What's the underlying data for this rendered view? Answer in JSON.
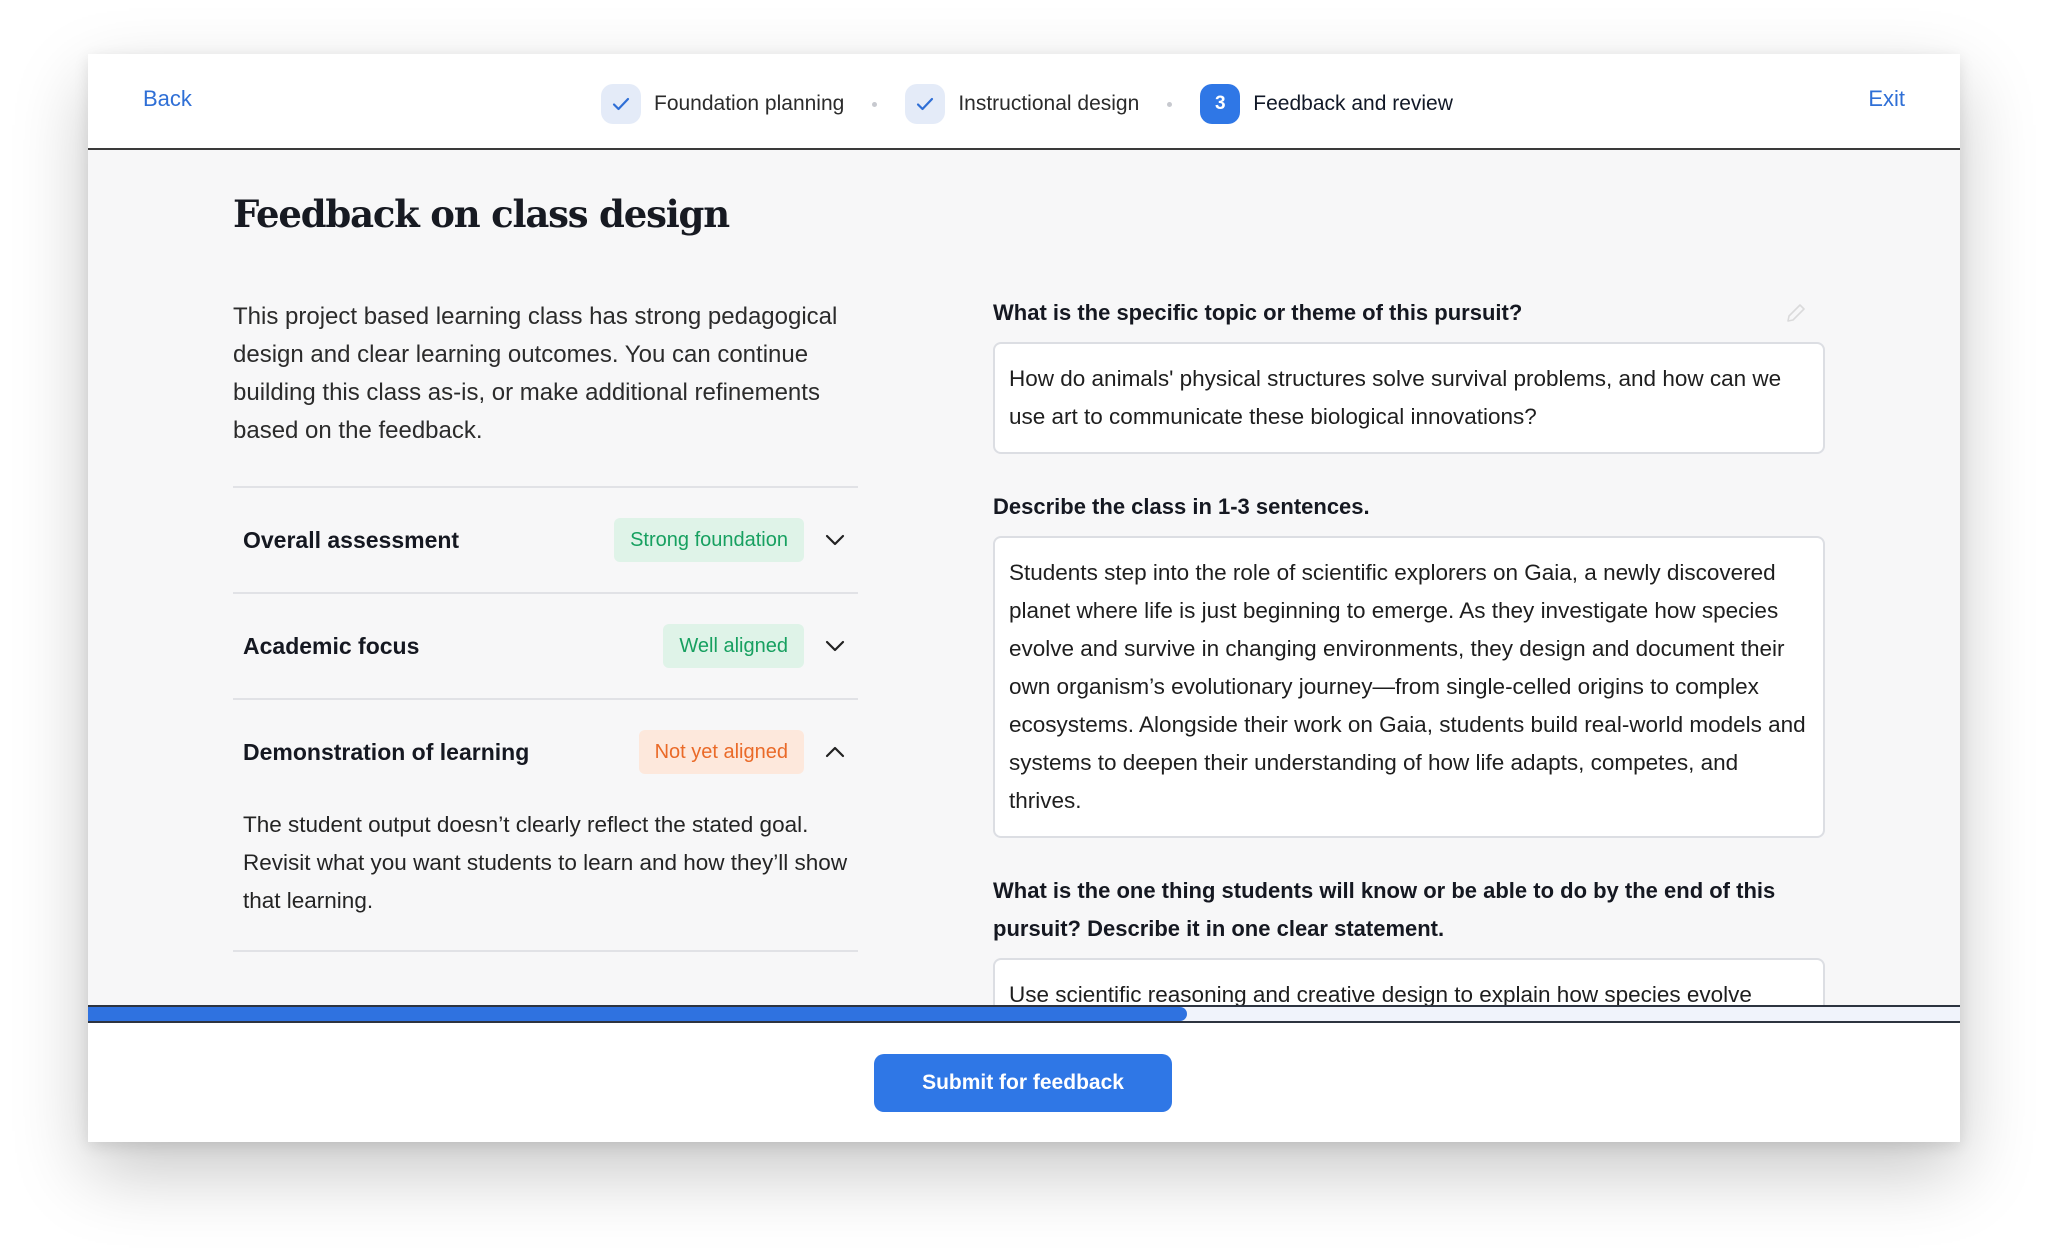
{
  "header": {
    "back_label": "Back",
    "exit_label": "Exit",
    "steps": [
      {
        "label": "Foundation planning",
        "state": "complete"
      },
      {
        "label": "Instructional design",
        "state": "complete"
      },
      {
        "label": "Feedback and review",
        "number": "3",
        "state": "active"
      }
    ]
  },
  "main": {
    "title": "Feedback on class design",
    "intro": "This project based learning class has strong pedagogical design and clear learning outcomes. You can continue building this class as-is, or make additional refinements based on the feedback.",
    "feedback": [
      {
        "title": "Overall assessment",
        "badge": "Strong foundation",
        "status": "green",
        "expanded": false
      },
      {
        "title": "Academic focus",
        "badge": "Well aligned",
        "status": "green",
        "expanded": false
      },
      {
        "title": "Demonstration of learning",
        "badge": "Not yet aligned",
        "status": "orange",
        "expanded": true,
        "body": "The student output doesn’t clearly reflect the stated goal. Revisit what you want students to learn and how they’ll show that learning."
      }
    ],
    "questions": [
      {
        "label": "What is the specific topic or theme of this pursuit?",
        "answer": "How do animals' physical structures solve survival problems, and how can we use art to communicate these biological innovations?"
      },
      {
        "label": "Describe the class in 1-3 sentences.",
        "answer": "Students step into the role of scientific explorers on Gaia, a newly discovered planet where life is just beginning to emerge. As they investigate how species evolve and survive in changing environments, they design and document their own organism’s evolutionary journey—from single-celled origins to complex ecosystems. Alongside their work on Gaia, students build real-world models and systems to deepen their understanding of how life adapts, competes, and thrives."
      },
      {
        "label": "What is the one thing students will know or be able to do by the end of this pursuit? Describe it in one clear statement.",
        "answer": "Use scientific reasoning and creative design to explain how species evolve"
      }
    ]
  },
  "progress": {
    "fraction": 0.587
  },
  "footer": {
    "submit_label": "Submit for feedback"
  },
  "colors": {
    "accent": "#2f77e6",
    "link": "#2f6fd6",
    "badge_green_text": "#17a060",
    "badge_green_bg": "#dff3e8",
    "badge_orange_text": "#ea6a28",
    "badge_orange_bg": "#fde8dc"
  },
  "icons": {
    "complete_step": "check-icon",
    "collapsed": "chevron-down-icon",
    "expanded": "chevron-up-icon",
    "edit": "pencil-icon"
  }
}
